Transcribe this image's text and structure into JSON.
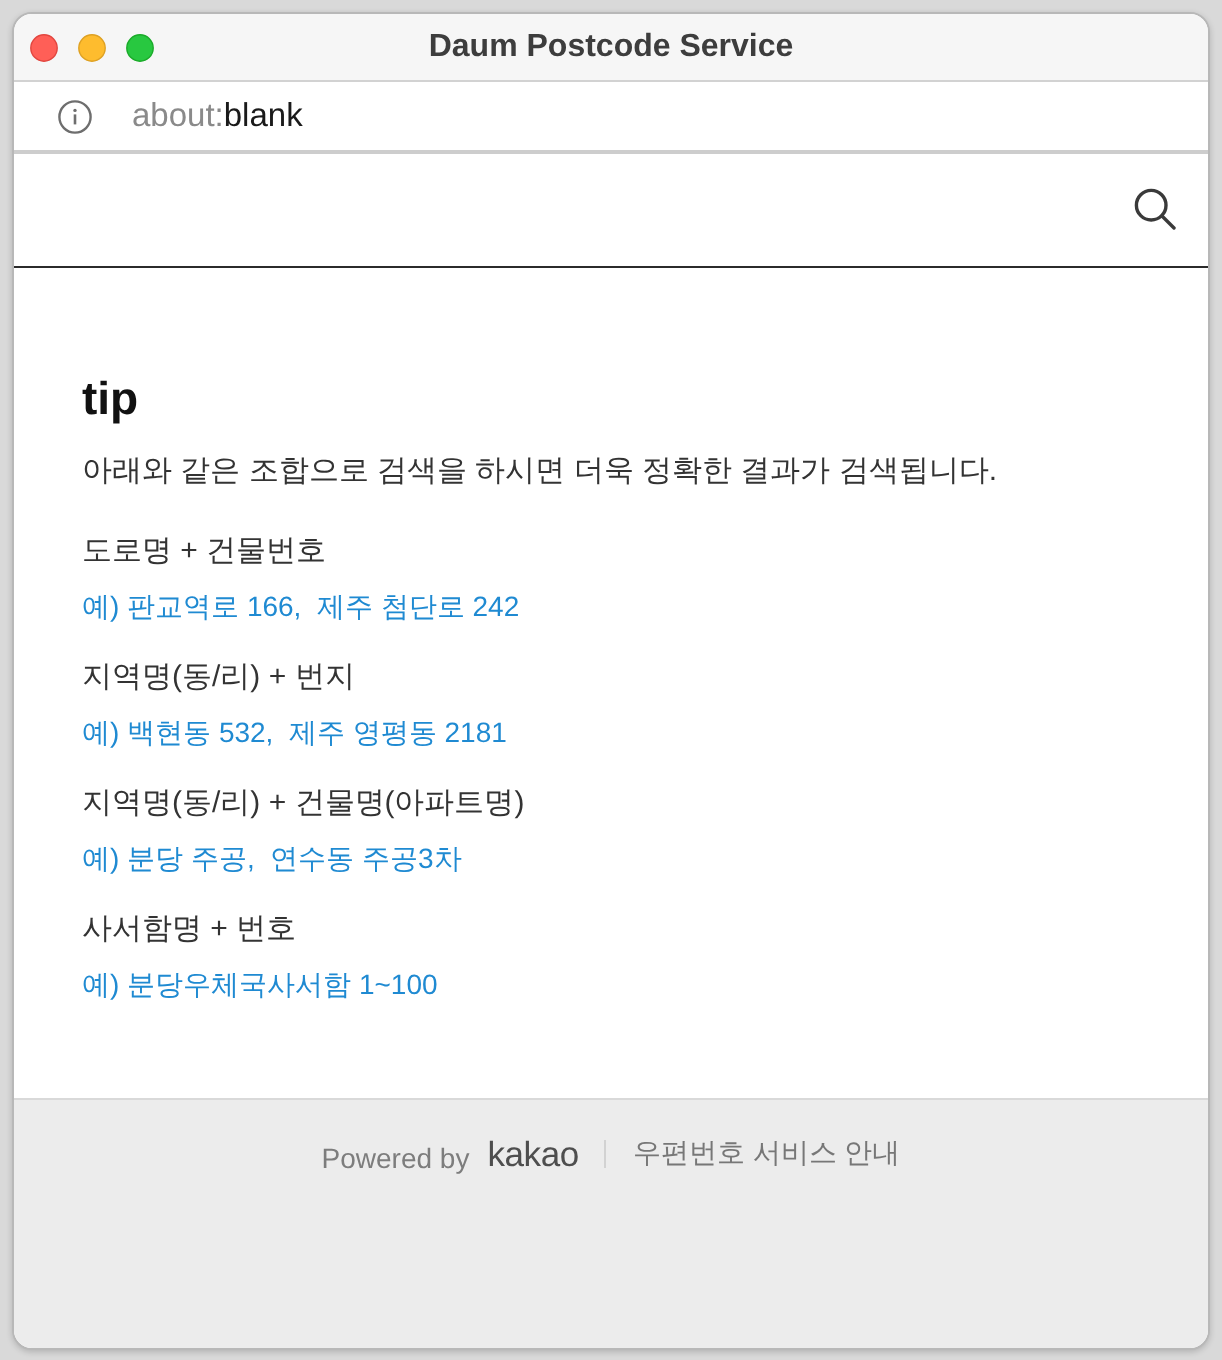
{
  "window": {
    "title": "Daum Postcode Service"
  },
  "address_bar": {
    "scheme": "about:",
    "address": "blank"
  },
  "tip": {
    "title": "tip",
    "description": "아래와 같은 조합으로 검색을 하시면 더욱 정확한 결과가 검색됩니다.",
    "items": [
      {
        "label": "도로명 + 건물번호",
        "example": "예) 판교역로 166,  제주 첨단로 242"
      },
      {
        "label": "지역명(동/리) + 번지",
        "example": "예) 백현동 532,  제주 영평동 2181"
      },
      {
        "label": "지역명(동/리) + 건물명(아파트명)",
        "example": "예) 분당 주공,  연수동 주공3차"
      },
      {
        "label": "사서함명 + 번호",
        "example": "예) 분당우체국사서함 1~100"
      }
    ]
  },
  "footer": {
    "powered_by": "Powered by",
    "brand": "kakao",
    "link": "우편번호 서비스 안내"
  }
}
